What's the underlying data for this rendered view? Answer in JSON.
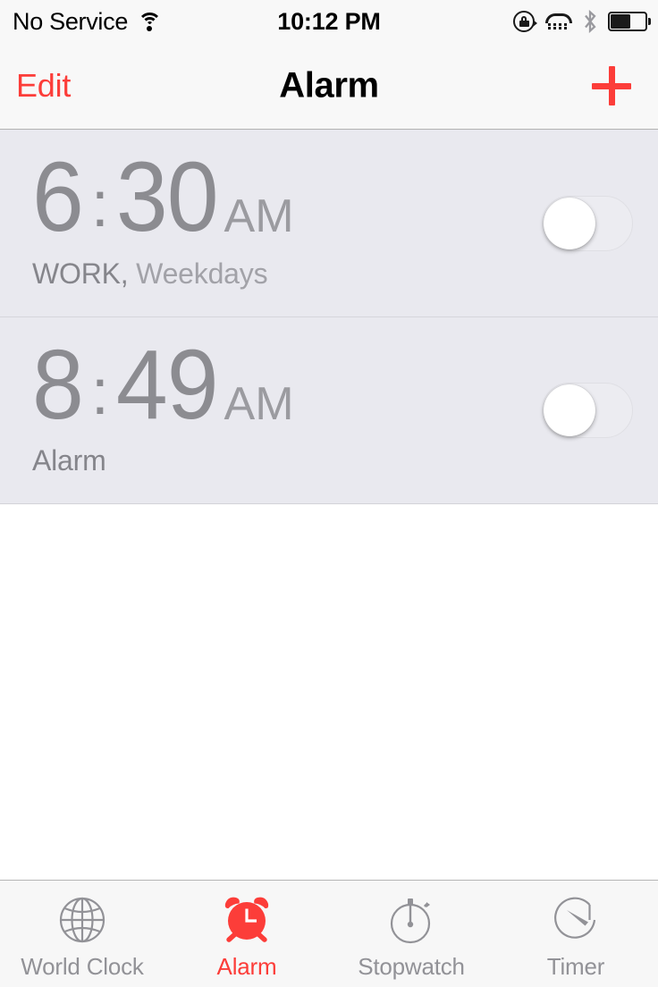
{
  "status_bar": {
    "carrier": "No Service",
    "time": "10:12 PM",
    "icons": [
      "wifi-icon",
      "rotation-lock-icon",
      "tty-icon",
      "bluetooth-icon",
      "battery-icon"
    ],
    "battery_level_percent": 55
  },
  "nav_bar": {
    "edit_label": "Edit",
    "title": "Alarm",
    "add_label": "+"
  },
  "alarms": [
    {
      "hour": "6",
      "separator": ":",
      "minute": "30",
      "meridiem": "AM",
      "label_primary": "WORK,",
      "label_secondary": "Weekdays",
      "enabled": false
    },
    {
      "hour": "8",
      "separator": ":",
      "minute": "49",
      "meridiem": "AM",
      "label_primary": "Alarm",
      "label_secondary": "",
      "enabled": false
    }
  ],
  "tab_bar": {
    "items": [
      {
        "label": "World Clock",
        "icon": "globe-icon",
        "active": false
      },
      {
        "label": "Alarm",
        "icon": "alarm-clock-icon",
        "active": true
      },
      {
        "label": "Stopwatch",
        "icon": "stopwatch-icon",
        "active": false
      },
      {
        "label": "Timer",
        "icon": "timer-icon",
        "active": false
      }
    ]
  },
  "colors": {
    "accent_red": "#fc3d39",
    "list_background": "#e9e9ef",
    "inactive_grey": "#929297",
    "time_grey": "#8c8c91"
  }
}
